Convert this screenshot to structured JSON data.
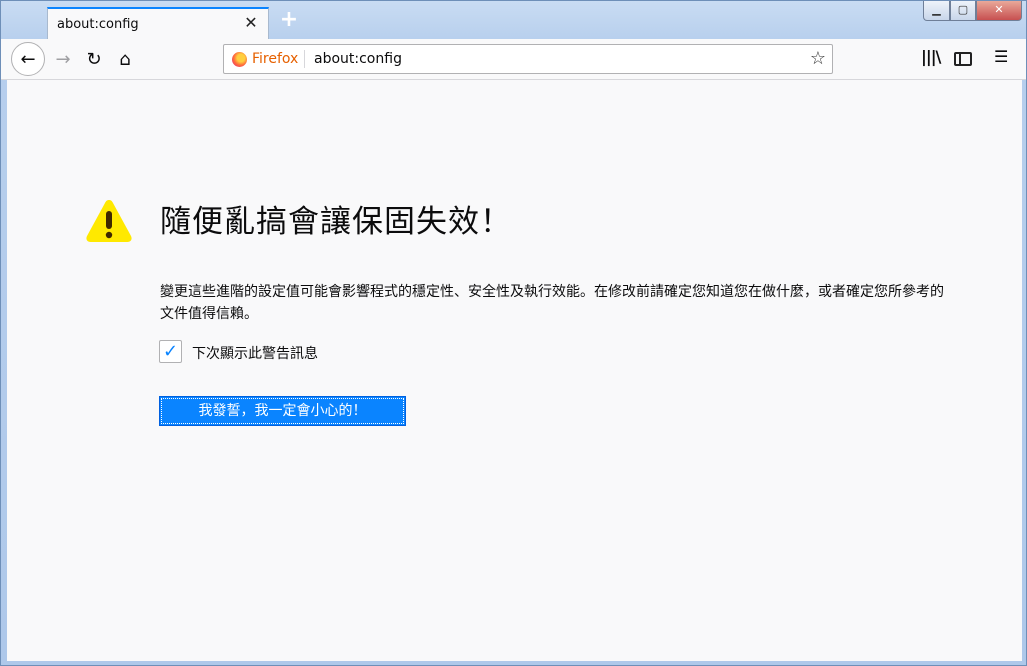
{
  "tab": {
    "title": "about:config",
    "close": "✕",
    "new_tab": "+"
  },
  "window_controls": {
    "min": "▁",
    "max": "▢",
    "close": "✕"
  },
  "nav": {
    "back": "←",
    "forward": "→",
    "reload": "↻",
    "home": "⌂",
    "url_identity": "Firefox",
    "url": "about:config",
    "bookmark": "☆",
    "library": "|||\\",
    "menu": "☰"
  },
  "warning": {
    "title": "隨便亂搞會讓保固失效！",
    "description": "變更這些進階的設定值可能會影響程式的穩定性、安全性及執行效能。在修改前請確定您知道您在做什麼，或者確定您所參考的文件值得信賴。",
    "checkbox_label": "下次顯示此警告訊息",
    "checkbox_mark": "✓",
    "button_label": "我發誓，我一定會小心的！"
  },
  "colors": {
    "accent": "#0a84ff",
    "warning": "#ffe900"
  }
}
